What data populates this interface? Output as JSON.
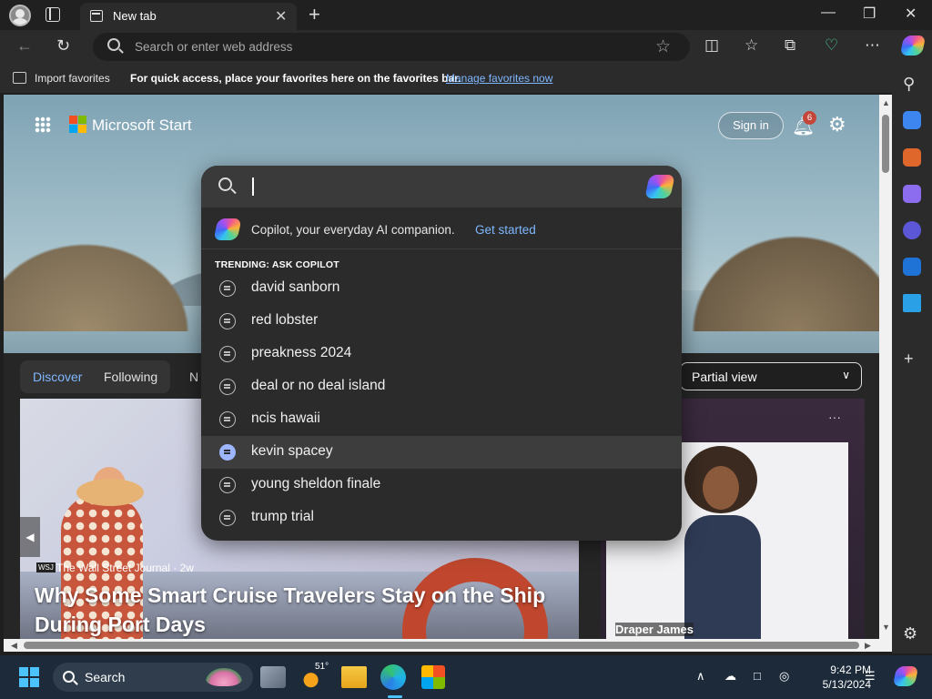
{
  "browser": {
    "tab_title": "New tab",
    "tab_close": "✕",
    "new_tab": "+",
    "minimize": "—",
    "restore": "❐",
    "close": "✕",
    "address_placeholder": "Search or enter web address"
  },
  "favorites_bar": {
    "import_label": "Import favorites",
    "tip": "For quick access, place your favorites here on the favorites bar.",
    "manage_link": "Manage favorites now"
  },
  "start_page": {
    "brand": "Microsoft Start",
    "sign_in": "Sign in",
    "notification_count": "6",
    "feed_tabs": {
      "discover": "Discover",
      "following": "Following",
      "partial_tab": "N"
    },
    "view_select": "Partial view",
    "news_card": {
      "source_icon": "WSJ",
      "source": "The Wall Street Journal · 2w",
      "title": "Why Some Smart Cruise Travelers Stay on the Ship During Port Days"
    },
    "ad_card": {
      "brand": "Draper James",
      "more": "···"
    }
  },
  "search_dropdown": {
    "promo_text": "Copilot, your everyday AI companion.",
    "promo_link": "Get started",
    "trending_header": "TRENDING: ASK COPILOT",
    "suggestions": [
      "david sanborn",
      "red lobster",
      "preakness 2024",
      "deal or no deal island",
      "ncis hawaii",
      "kevin spacey",
      "young sheldon finale",
      "trump trial"
    ],
    "hovered_index": 5
  },
  "taskbar": {
    "search_label": "Search",
    "weather_temp": "51°",
    "time": "9:42 PM",
    "date": "5/13/2024"
  },
  "colors": {
    "accent_blue": "#7fb7ff",
    "windows_blue": "#4cc2ff",
    "badge_red": "#c4463b"
  }
}
